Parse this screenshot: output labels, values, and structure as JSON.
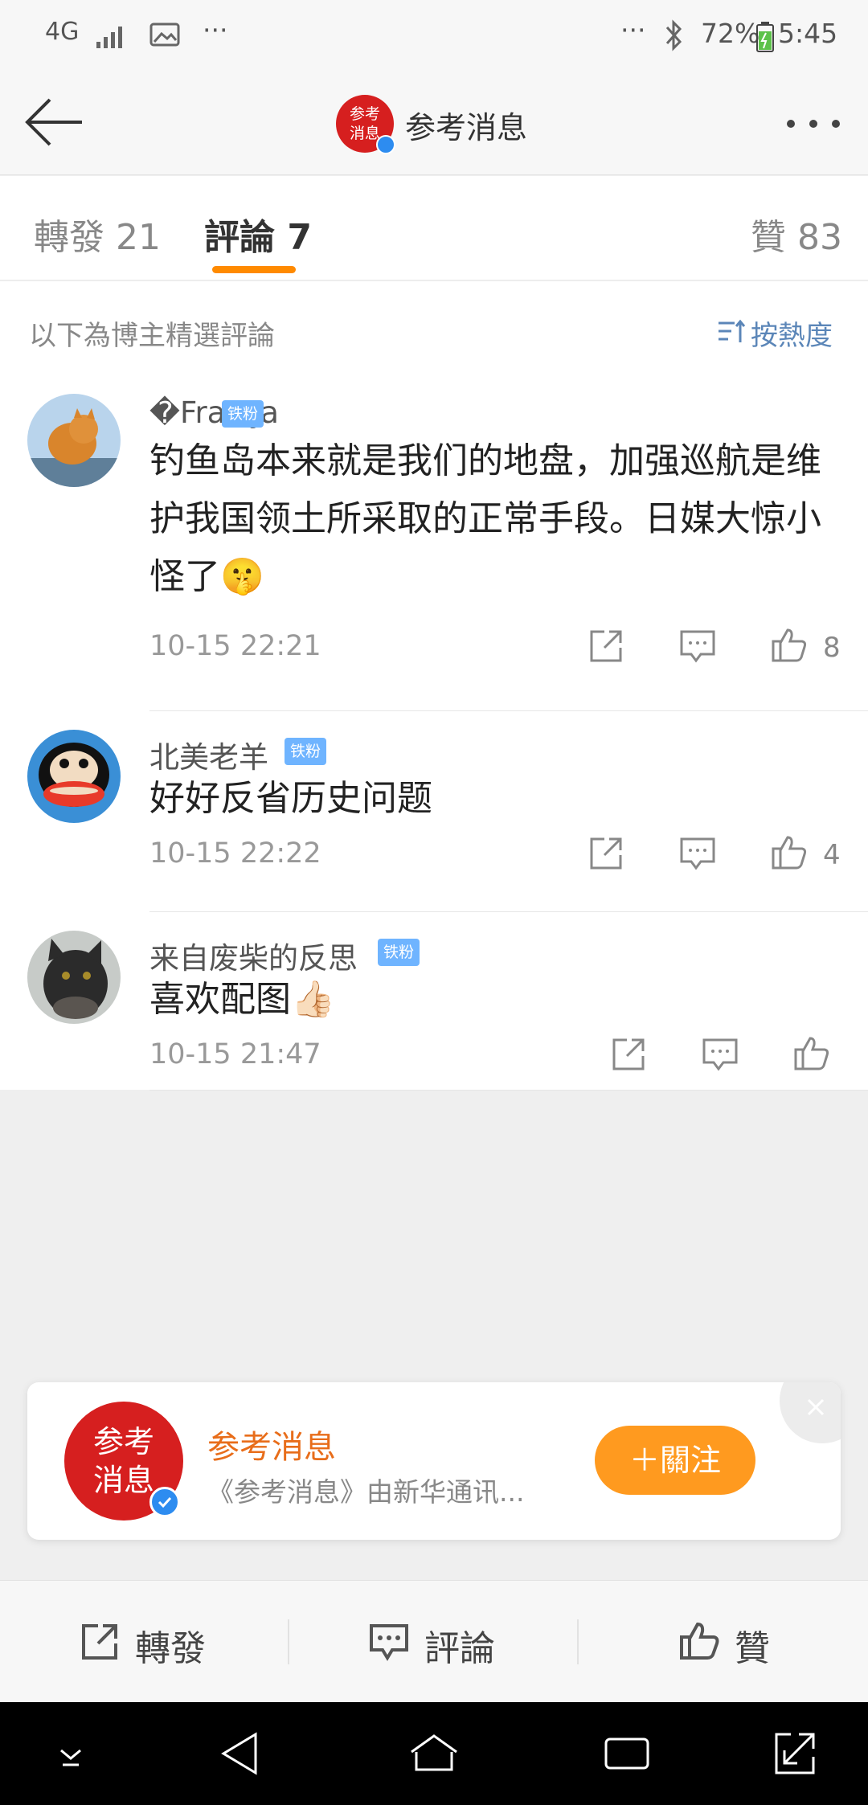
{
  "status_bar": {
    "network": "4G",
    "battery": "72%",
    "time": "5:45",
    "overflow": "···"
  },
  "header": {
    "account_name": "参考消息",
    "logo_text": "参考消息"
  },
  "tabs": [
    {
      "label": "轉發 21"
    },
    {
      "label": "評論 7"
    },
    {
      "label": "贊 83"
    }
  ],
  "comments_section": {
    "hint": "以下為博主精選評論",
    "sort_label": "按熱度"
  },
  "comments": [
    {
      "user": "�França",
      "badge": "铁粉",
      "text": "钓鱼岛本来就是我们的地盘，加强巡航是维护我国领土所采取的正常手段。日媒大惊小怪了🤫",
      "time": "10-15 22:21",
      "likes": "8"
    },
    {
      "user": "北美老羊",
      "badge": "铁粉",
      "text": "好好反省历史问题",
      "time": "10-15 22:22",
      "likes": "4"
    },
    {
      "user": "来自废柴的反思",
      "badge": "铁粉",
      "text": "喜欢配图👍🏻",
      "time": "10-15 21:47",
      "likes": ""
    }
  ],
  "recommendation": {
    "name": "参考消息",
    "description": "《参考消息》由新华通讯...",
    "follow_label": "＋關注"
  },
  "toolbar": {
    "repost": "轉發",
    "comment": "評論",
    "like": "贊"
  },
  "colors": {
    "accent": "#ff8a00",
    "brand_red": "#d61f1f",
    "badge_blue": "#6fb4ff",
    "link_blue": "#5b86b8"
  }
}
